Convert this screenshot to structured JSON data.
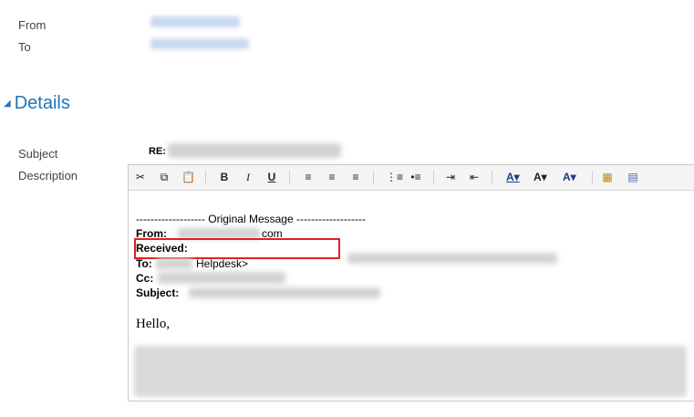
{
  "header": {
    "from_label": "From",
    "to_label": "To"
  },
  "details": {
    "title": "Details",
    "subject_label": "Subject",
    "subject_prefix": "RE:",
    "description_label": "Description"
  },
  "editor": {
    "original_message": "------------------- Original Message -------------------",
    "from_label": "From:",
    "from_tail": "com",
    "received_label": "Received:",
    "to_label": "To:",
    "to_visible": "Helpdesk>",
    "cc_label": "Cc:",
    "subject_label": "Subject:",
    "greeting": "Hello,"
  },
  "colors": {
    "accent": "#1e73be",
    "highlight_box": "#e02020"
  }
}
